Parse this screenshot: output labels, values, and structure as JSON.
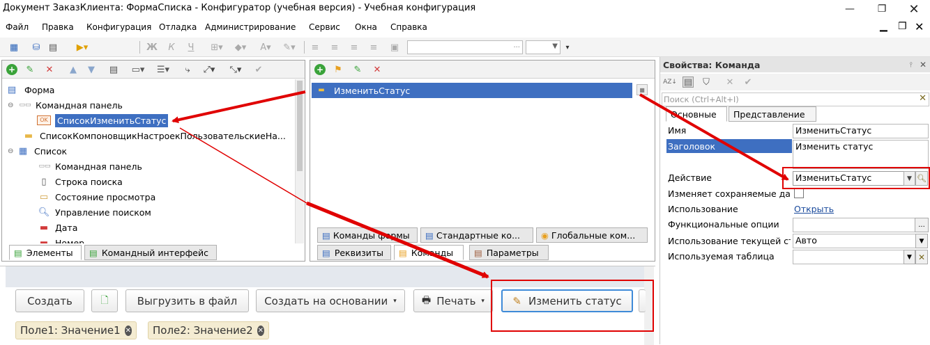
{
  "window": {
    "title": "Документ ЗаказКлиента: ФормаСписка - Конфигуратор (учебная версия) - Учебная конфигурация"
  },
  "menu": [
    "Файл",
    "Правка",
    "Конфигурация",
    "Отладка",
    "Администрирование",
    "Сервис",
    "Окна",
    "Справка"
  ],
  "elements_panel": {
    "tree": [
      {
        "label": "Форма",
        "icon": "form-icon"
      },
      {
        "label": "Командная панель",
        "icon": "command-panel-icon"
      },
      {
        "label": "СписокИзменитьСтатус",
        "icon": "ok-button-icon"
      },
      {
        "label": "СписокКомпоновщикНастроекПользовательскиеНа...",
        "icon": "folder-icon"
      },
      {
        "label": "Список",
        "icon": "table-icon"
      },
      {
        "label": "Командная панель",
        "icon": "command-panel-icon"
      },
      {
        "label": "Строка поиска",
        "icon": "search-string-icon"
      },
      {
        "label": "Состояние просмотра",
        "icon": "view-state-icon"
      },
      {
        "label": "Управление поиском",
        "icon": "search-control-icon"
      },
      {
        "label": "Дата",
        "icon": "field-icon"
      },
      {
        "label": "Номер",
        "icon": "field-icon"
      }
    ],
    "tabs": [
      "Элементы",
      "Командный интерфейс"
    ]
  },
  "commands_panel": {
    "items": [
      "ИзменитьСтатус"
    ],
    "inner_tabs": [
      "Команды формы",
      "Стандартные ко...",
      "Глобальные ком..."
    ],
    "tabs": [
      "Реквизиты",
      "Команды",
      "Параметры"
    ]
  },
  "properties": {
    "title": "Свойства: Команда",
    "search_placeholder": "Поиск (Ctrl+Alt+I)",
    "tabs": [
      "Основные",
      "Представление"
    ],
    "rows": {
      "name_label": "Имя",
      "name_value": "ИзменитьСтатус",
      "title_label": "Заголовок",
      "title_value": "Изменить статус",
      "action_label": "Действие",
      "action_value": "ИзменитьСтатус",
      "modifies_label": "Изменяет сохраняемые да",
      "usage_label": "Использование",
      "usage_value": "Открыть",
      "fo_label": "Функциональные опции",
      "cur_usage_label": "Использование текущей ст",
      "cur_usage_value": "Авто",
      "table_label": "Используемая таблица"
    }
  },
  "preview": {
    "buttons": [
      "Создать",
      "Выгрузить в файл",
      "Создать на основании",
      "Печать",
      "Изменить статус"
    ],
    "chips": [
      "Поле1: Значение1",
      "Поле2: Значение2"
    ]
  },
  "colors": {
    "selection": "#3e6fc1",
    "annotation": "#e00000",
    "green": "#3aa33a",
    "red": "#d23b3b"
  }
}
